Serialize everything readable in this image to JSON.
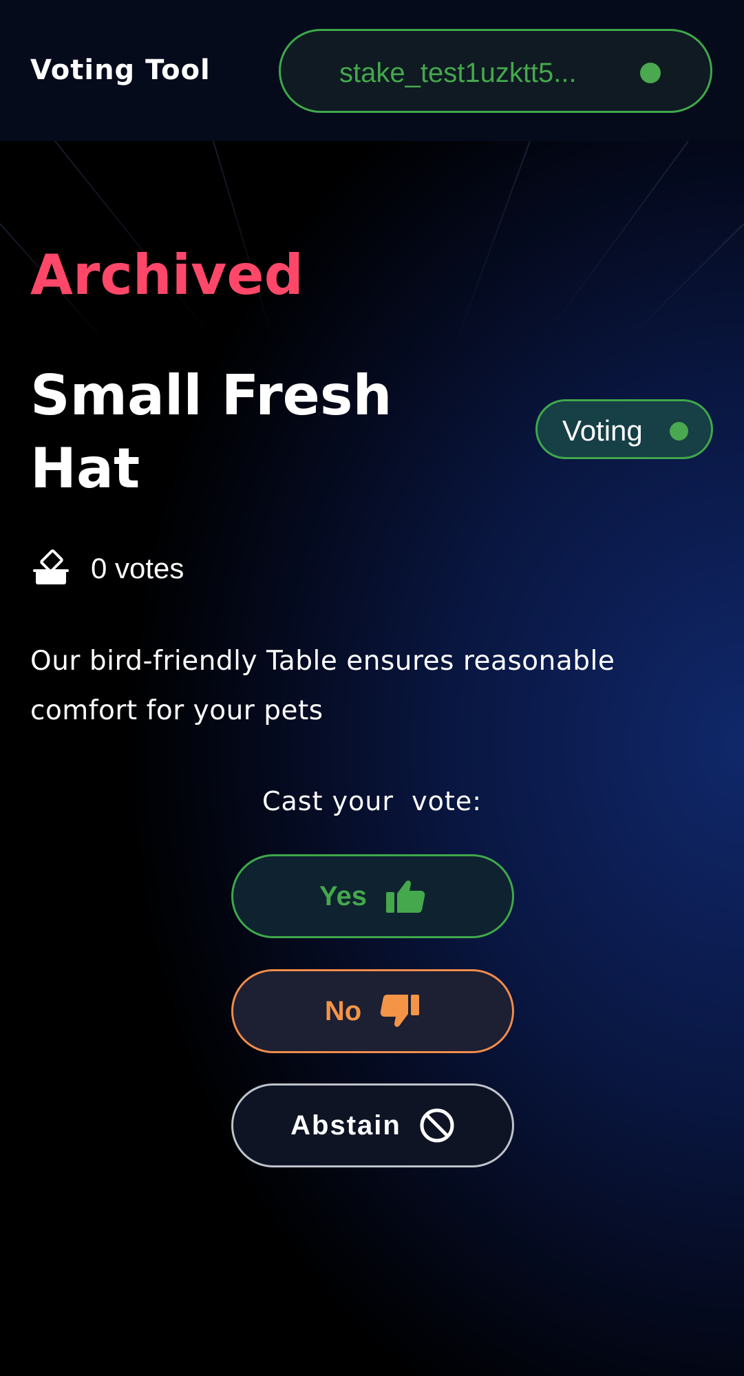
{
  "header": {
    "app_title": "Voting Tool",
    "wallet_address": "stake_test1uzktt5...",
    "wallet_status_color": "#4aa84f"
  },
  "proposal": {
    "status_heading": "Archived",
    "status_heading_color": "#ff4869",
    "title": "Small Fresh Hat",
    "phase_badge": "Voting",
    "votes_count": "0 votes",
    "description": "Our bird-friendly Table ensures reasonable comfort for your pets"
  },
  "vote": {
    "prompt": "Cast your  vote:",
    "options": [
      {
        "label": "Yes",
        "icon": "thumbs-up-icon",
        "color": "#45a84c"
      },
      {
        "label": "No",
        "icon": "thumbs-down-icon",
        "color": "#f39447"
      },
      {
        "label": "Abstain",
        "icon": "prohibited-icon",
        "color": "#ffffff"
      }
    ]
  }
}
